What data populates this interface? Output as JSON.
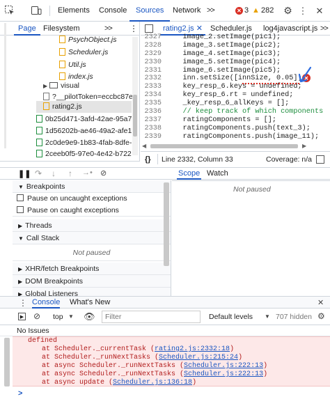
{
  "toolbar": {
    "tabs": [
      "Elements",
      "Console",
      "Sources",
      "Network"
    ],
    "more": ">>",
    "error_count": "3",
    "warning_count": "282"
  },
  "navigator": {
    "tabs": [
      "Page",
      "Filesystem"
    ],
    "more": ">>",
    "files": [
      {
        "name": "PsychObject.js",
        "type": "js"
      },
      {
        "name": "Scheduler.js",
        "type": "js"
      },
      {
        "name": "Util.js",
        "type": "js"
      },
      {
        "name": "index.js",
        "type": "js"
      },
      {
        "name": "visual",
        "type": "folder"
      },
      {
        "name": "?__pilotToken=eccbc87e4",
        "type": "doc"
      },
      {
        "name": "rating2.js",
        "type": "js-selected"
      },
      {
        "name": "0b25d471-3afd-42ae-95a7-",
        "type": "cloud"
      },
      {
        "name": "1d56202b-ae46-49a2-afe1-",
        "type": "cloud"
      },
      {
        "name": "2c0de9e9-1b83-4fab-8dfe-",
        "type": "cloud"
      },
      {
        "name": "2ceeb0f5-97e0-4e42-b722-",
        "type": "cloud"
      }
    ]
  },
  "editor": {
    "tabs": [
      "rating2.js",
      "Scheduler.js",
      "log4javascript.js"
    ],
    "more": ">>",
    "lines": [
      {
        "n": "2327",
        "code": "    image_2.setImage(pic1);"
      },
      {
        "n": "2328",
        "code": "    image_3.setImage(pic2);"
      },
      {
        "n": "2329",
        "code": "    image_4.setImage(pic3);"
      },
      {
        "n": "2330",
        "code": "    image_5.setImage(pic4);"
      },
      {
        "n": "2331",
        "code": "    image_6.setImage(pic5);"
      },
      {
        "n": "2332",
        "code": "    inn.setSize([innSize, 0.05]);"
      },
      {
        "n": "2333",
        "code": "    key_resp_6.keys = undefined;"
      },
      {
        "n": "2334",
        "code": "    key_resp_6.rt = undefined;"
      },
      {
        "n": "2335",
        "code": "    _key_resp_6_allKeys = [];"
      },
      {
        "n": "2336",
        "code": "    // keep track of which components"
      },
      {
        "n": "2337",
        "code": "    ratingComponents = [];"
      },
      {
        "n": "2338",
        "code": "    ratingComponents.push(text_3);"
      },
      {
        "n": "2339",
        "code": "    ratingComponents.push(image_11);"
      }
    ],
    "status": "Line 2332, Column 33",
    "coverage": "Coverage: n/a"
  },
  "debugger": {
    "scope_tabs": [
      "Scope",
      "Watch"
    ],
    "not_paused": "Not paused",
    "sections": {
      "breakpoints": "Breakpoints",
      "pause_uncaught": "Pause on uncaught exceptions",
      "pause_caught": "Pause on caught exceptions",
      "threads": "Threads",
      "call_stack": "Call Stack",
      "call_stack_status": "Not paused",
      "xhr": "XHR/fetch Breakpoints",
      "dom": "DOM Breakpoints",
      "global": "Global Listeners"
    }
  },
  "drawer": {
    "tabs": [
      "Console",
      "What's New"
    ],
    "context": "top",
    "filter_placeholder": "Filter",
    "levels": "Default levels",
    "hidden": "707 hidden",
    "issues": "No Issues",
    "error_head": "defined",
    "stack": [
      {
        "prefix": "at Scheduler._currentTask (",
        "link": "rating2.js:2332:18",
        "suffix": ")"
      },
      {
        "prefix": "at Scheduler._runNextTasks (",
        "link": "Scheduler.js:215:24",
        "suffix": ")"
      },
      {
        "prefix": "at async Scheduler._runNextTasks (",
        "link": "Scheduler.js:222:13",
        "suffix": ")"
      },
      {
        "prefix": "at async Scheduler._runNextTasks (",
        "link": "Scheduler.js:222:13",
        "suffix": ")"
      },
      {
        "prefix": "at async update (",
        "link": "Scheduler.js:136:18",
        "suffix": ")"
      }
    ],
    "prompt": ">"
  },
  "colors": {
    "accent": "#1a56c2",
    "error": "#d93025",
    "warning": "#e8a100"
  }
}
